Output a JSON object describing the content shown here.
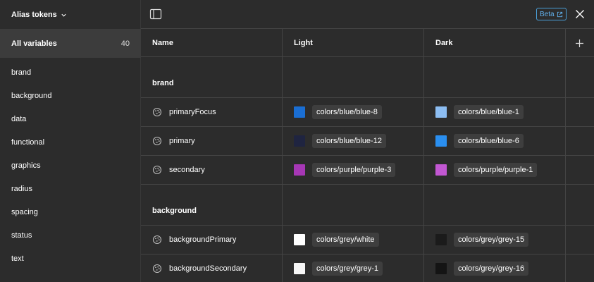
{
  "sidebar": {
    "collection_label": "Alias tokens",
    "all_variables": {
      "label": "All variables",
      "count": "40"
    },
    "groups": [
      "brand",
      "background",
      "data",
      "functional",
      "graphics",
      "radius",
      "spacing",
      "status",
      "text"
    ]
  },
  "topbar": {
    "beta_label": "Beta"
  },
  "table": {
    "columns": {
      "name": "Name",
      "light": "Light",
      "dark": "Dark"
    },
    "sections": [
      {
        "title": "brand",
        "rows": [
          {
            "name": "primaryFocus",
            "light": {
              "color": "#1a6ed3",
              "value": "colors/blue/blue-8"
            },
            "dark": {
              "color": "#8cbdf2",
              "value": "colors/blue/blue-1"
            }
          },
          {
            "name": "primary",
            "light": {
              "color": "#1f2440",
              "value": "colors/blue/blue-12"
            },
            "dark": {
              "color": "#2a8ff0",
              "value": "colors/blue/blue-6"
            }
          },
          {
            "name": "secondary",
            "light": {
              "color": "#a637b5",
              "value": "colors/purple/purple-3"
            },
            "dark": {
              "color": "#c257d2",
              "value": "colors/purple/purple-1"
            }
          }
        ]
      },
      {
        "title": "background",
        "rows": [
          {
            "name": "backgroundPrimary",
            "light": {
              "color": "#ffffff",
              "value": "colors/grey/white"
            },
            "dark": {
              "color": "#1b1b1b",
              "value": "colors/grey/grey-15"
            }
          },
          {
            "name": "backgroundSecondary",
            "light": {
              "color": "#f6f6f6",
              "value": "colors/grey/grey-1"
            },
            "dark": {
              "color": "#141414",
              "value": "colors/grey/grey-16"
            }
          }
        ]
      }
    ]
  }
}
